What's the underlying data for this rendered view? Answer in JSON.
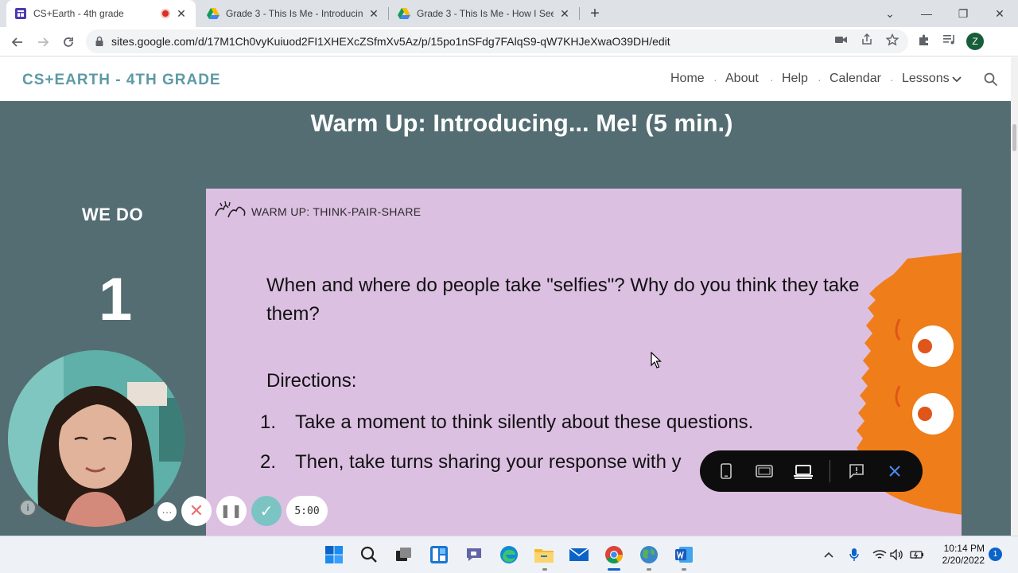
{
  "browser": {
    "tabs": [
      {
        "title": "CS+Earth - 4th grade",
        "active": true,
        "recording": true
      },
      {
        "title": "Grade 3 - This Is Me - Introducin",
        "active": false
      },
      {
        "title": "Grade 3 - This Is Me - How I See",
        "active": false
      }
    ],
    "new_tab": "+",
    "window_controls": {
      "menu": "⌄",
      "minimize": "—",
      "restore": "❐",
      "close": "✕"
    },
    "url": "sites.google.com/d/17M1Ch0vyKuiuod2FI1XHEXcZSfmXv5Az/p/15po1nSFdg7FAlqS9-qW7KHJeXwaO39DH/edit",
    "profile_initial": "Z"
  },
  "site": {
    "title": "CS+EARTH - 4TH GRADE",
    "nav": [
      "Home",
      "About",
      "Help",
      "Calendar",
      "Lessons"
    ],
    "nav_separator": "·",
    "lessons_caret": "⌄"
  },
  "page": {
    "heading": "Warm Up: Introducing... Me! (5 min.)",
    "mode_label": "WE DO",
    "step_number": "1",
    "slide": {
      "label": "WARM UP: THINK-PAIR-SHARE",
      "question": "When and where do people take \"selfies\"? Why do you think they take them?",
      "directions_label": "Directions:",
      "steps": [
        {
          "num": "1.",
          "text": "Take a moment to think silently about these questions."
        },
        {
          "num": "2.",
          "text": "Then, take turns sharing your response with y"
        }
      ]
    },
    "colors": {
      "page_bg": "#536d72",
      "slide_bg": "#dcc0e2",
      "site_title": "#5d9aa4",
      "monster": "#ef7d1a"
    }
  },
  "recorder": {
    "info": "i",
    "more": "···",
    "cancel": "✕",
    "pause": "❚❚",
    "done": "✓",
    "timer": "5:00"
  },
  "device_toolbar": {
    "buttons": [
      "phone-icon",
      "tablet-icon",
      "laptop-icon",
      "feedback-icon",
      "close-icon"
    ],
    "active": "laptop-icon"
  },
  "taskbar": {
    "apps": [
      "start-icon",
      "search-icon",
      "task-view-icon",
      "widgets-icon",
      "teams-chat-icon",
      "edge-icon",
      "file-explorer-icon",
      "mail-icon",
      "chrome-icon",
      "earth-icon",
      "word-icon"
    ],
    "active_app": "chrome-icon",
    "time": "10:14 PM",
    "date": "2/20/2022",
    "notifications": "1"
  }
}
